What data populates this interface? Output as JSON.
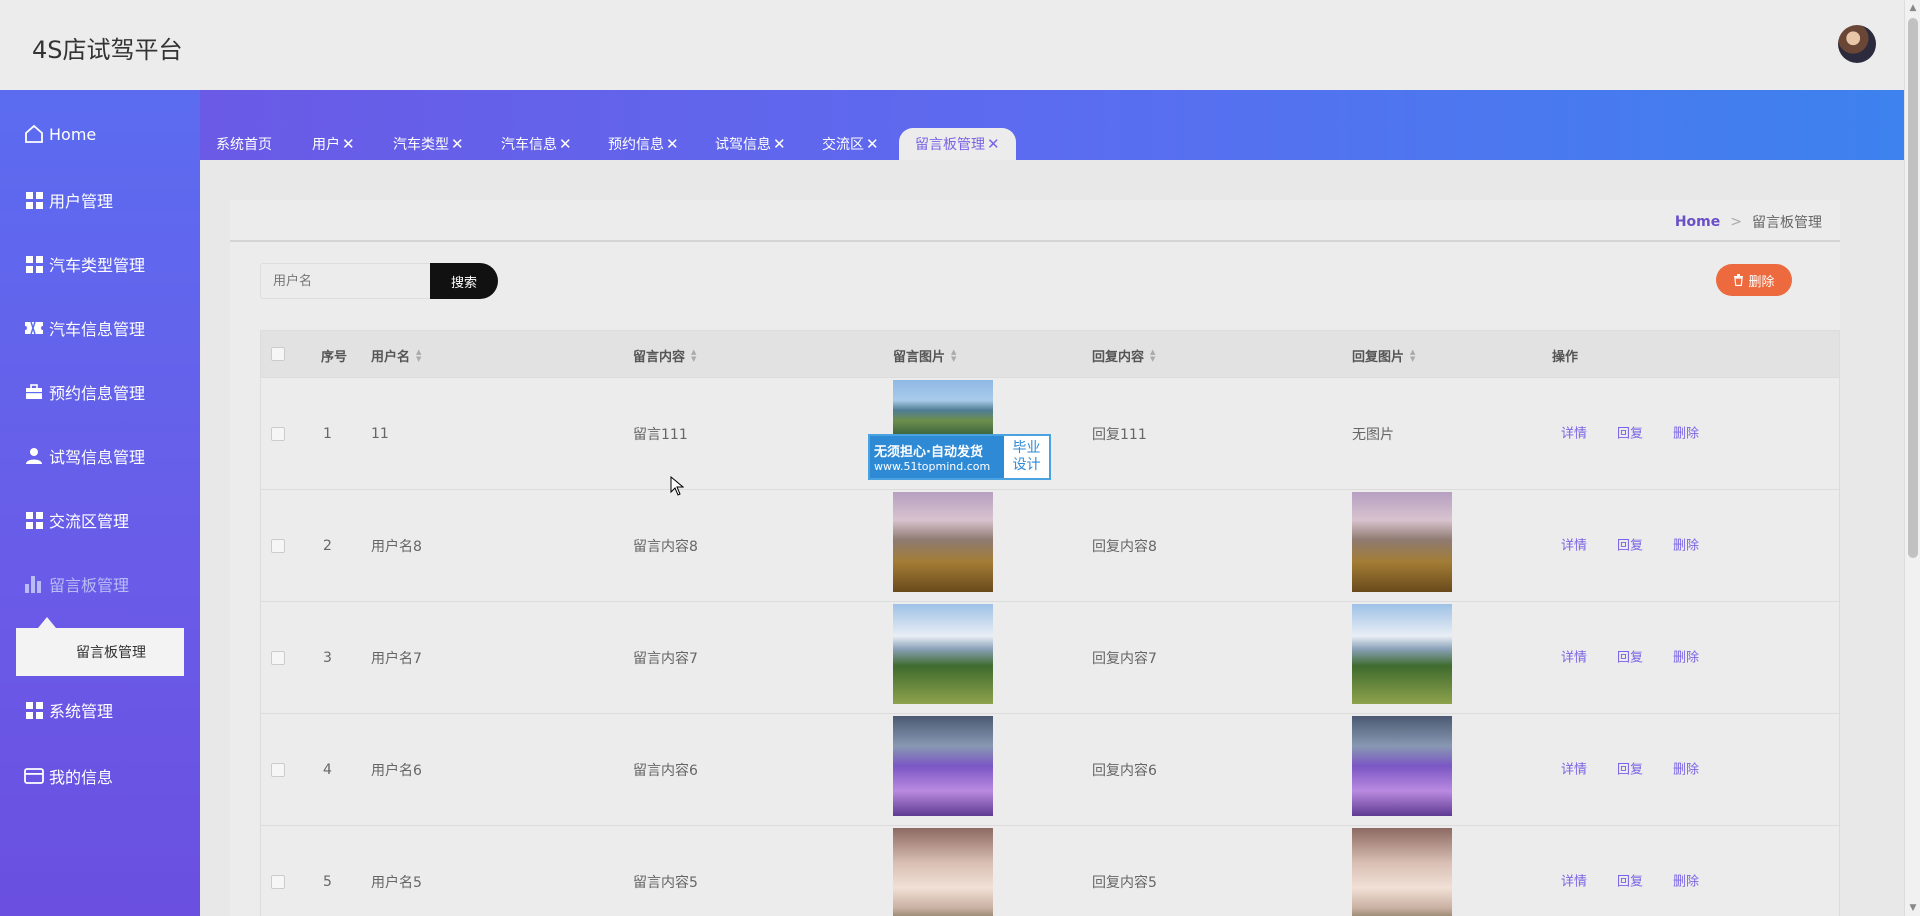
{
  "app": {
    "title": "4S店试驾平台"
  },
  "sidebar": {
    "items": [
      {
        "label": "Home",
        "icon": "home-icon"
      },
      {
        "label": "用户管理",
        "icon": "grid-icon"
      },
      {
        "label": "汽车类型管理",
        "icon": "grid-icon"
      },
      {
        "label": "汽车信息管理",
        "icon": "ticket-icon"
      },
      {
        "label": "预约信息管理",
        "icon": "briefcase-icon"
      },
      {
        "label": "试驾信息管理",
        "icon": "user-icon"
      },
      {
        "label": "交流区管理",
        "icon": "grid-icon"
      },
      {
        "label": "留言板管理",
        "icon": "bar-chart-icon"
      },
      {
        "label": "系统管理",
        "icon": "grid-icon"
      },
      {
        "label": "我的信息",
        "icon": "card-icon"
      }
    ],
    "submenu": {
      "label": "留言板管理"
    }
  },
  "tabs": [
    {
      "label": "系统首页",
      "closable": false
    },
    {
      "label": "用户",
      "closable": true
    },
    {
      "label": "汽车类型",
      "closable": true
    },
    {
      "label": "汽车信息",
      "closable": true
    },
    {
      "label": "预约信息",
      "closable": true
    },
    {
      "label": "试驾信息",
      "closable": true
    },
    {
      "label": "交流区",
      "closable": true
    },
    {
      "label": "留言板管理",
      "closable": true,
      "active": true
    }
  ],
  "breadcrumb": {
    "home": "Home",
    "separator": ">",
    "current": "留言板管理"
  },
  "search": {
    "placeholder": "用户名",
    "button": "搜索"
  },
  "toolbar": {
    "delete_label": "删除"
  },
  "table": {
    "headers": {
      "index": "序号",
      "username": "用户名",
      "content": "留言内容",
      "image": "留言图片",
      "reply": "回复内容",
      "reply_image": "回复图片",
      "actions": "操作"
    },
    "rows": [
      {
        "index": "1",
        "username": "11",
        "content": "留言111",
        "image": "city",
        "reply": "回复111",
        "reply_image": "无图片"
      },
      {
        "index": "2",
        "username": "用户名8",
        "content": "留言内容8",
        "image": "mountain",
        "reply": "回复内容8",
        "reply_image": "mountain"
      },
      {
        "index": "3",
        "username": "用户名7",
        "content": "留言内容7",
        "image": "alps",
        "reply": "回复内容7",
        "reply_image": "alps"
      },
      {
        "index": "4",
        "username": "用户名6",
        "content": "留言内容6",
        "image": "lavender",
        "reply": "回复内容6",
        "reply_image": "lavender"
      },
      {
        "index": "5",
        "username": "用户名5",
        "content": "留言内容5",
        "image": "fog",
        "reply": "回复内容5",
        "reply_image": "fog"
      }
    ],
    "actions": {
      "detail": "详情",
      "reply": "回复",
      "delete": "删除"
    }
  },
  "watermark": {
    "line1": "无须担心·自动发货",
    "line2": "www.51topmind.com",
    "right1": "毕业",
    "right2": "设计"
  },
  "colors": {
    "accent": "#7b63e6",
    "sidebar_top": "#5b6cf0",
    "delete": "#ec6a3d",
    "search_button": "#111111"
  }
}
